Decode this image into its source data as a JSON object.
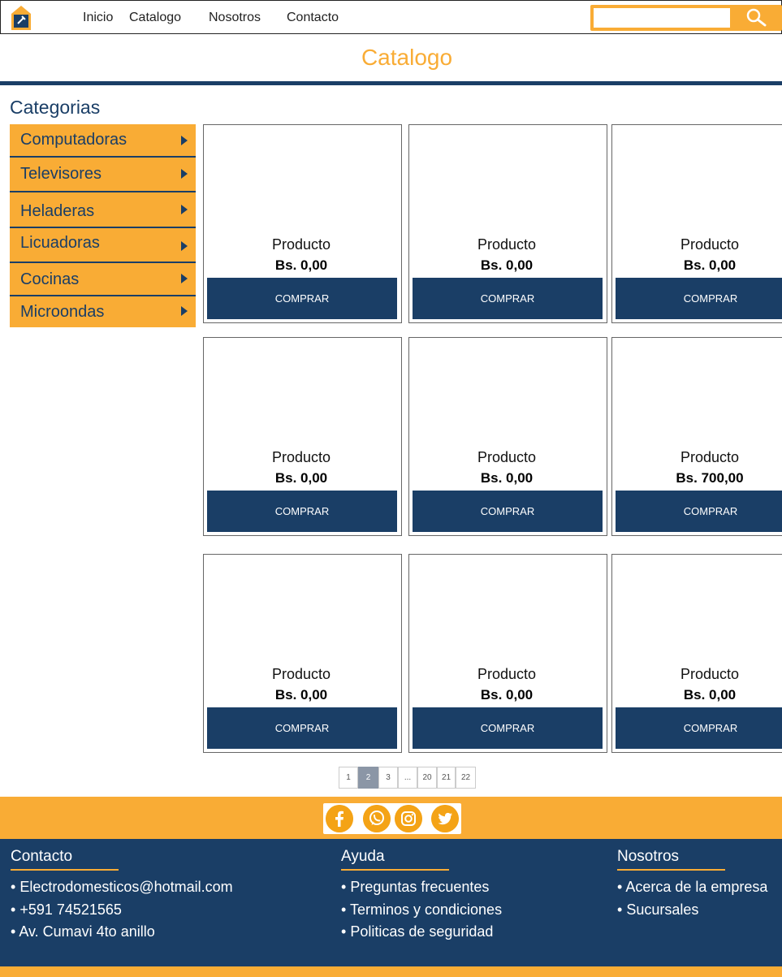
{
  "nav": {
    "logo_icon": "house-plug-icon",
    "links": [
      "Inicio",
      "Catalogo",
      "Nosotros",
      "Contacto"
    ],
    "search_value": "",
    "search_icon": "magnifier-icon"
  },
  "page": {
    "title": "Catalogo"
  },
  "sidebar": {
    "heading": "Categorias",
    "items": [
      {
        "label": "Computadoras"
      },
      {
        "label": "Televisores"
      },
      {
        "label": "Heladeras"
      },
      {
        "label": "Licuadoras"
      },
      {
        "label": "Cocinas"
      },
      {
        "label": "Microondas"
      }
    ]
  },
  "products": [
    {
      "name": "Producto",
      "price": "Bs. 0,00",
      "button": "COMPRAR"
    },
    {
      "name": "Producto",
      "price": "Bs. 0,00",
      "button": "COMPRAR"
    },
    {
      "name": "Producto",
      "price": "Bs. 0,00",
      "button": "COMPRAR"
    },
    {
      "name": "Producto",
      "price": "Bs. 0,00",
      "button": "COMPRAR"
    },
    {
      "name": "Producto",
      "price": "Bs. 0,00",
      "button": "COMPRAR"
    },
    {
      "name": "Producto",
      "price": "Bs. 700,00",
      "button": "COMPRAR"
    },
    {
      "name": "Producto",
      "price": "Bs. 0,00",
      "button": "COMPRAR"
    },
    {
      "name": "Producto",
      "price": "Bs. 0,00",
      "button": "COMPRAR"
    },
    {
      "name": "Producto",
      "price": "Bs. 0,00",
      "button": "COMPRAR"
    }
  ],
  "pagination": {
    "pages": [
      "1",
      "2",
      "3",
      "...",
      "20",
      "21",
      "22"
    ],
    "current": "2"
  },
  "social": [
    "facebook-icon",
    "whatsapp-icon",
    "instagram-icon",
    "twitter-icon"
  ],
  "footer": {
    "contacto": {
      "heading": "Contacto",
      "items": [
        "Electrodomesticos@hotmail.com",
        "+591 74521565",
        "Av. Cumavi 4to anillo"
      ]
    },
    "ayuda": {
      "heading": "Ayuda",
      "items": [
        "Preguntas frecuentes",
        "Terminos y condiciones",
        "Politicas de seguridad"
      ]
    },
    "nosotros": {
      "heading": "Nosotros",
      "items": [
        "Acerca de la empresa",
        "Sucursales"
      ]
    }
  },
  "colors": {
    "accent": "#f9ac35",
    "navy": "#1a3e66",
    "pager_active": "#8b96a6"
  }
}
